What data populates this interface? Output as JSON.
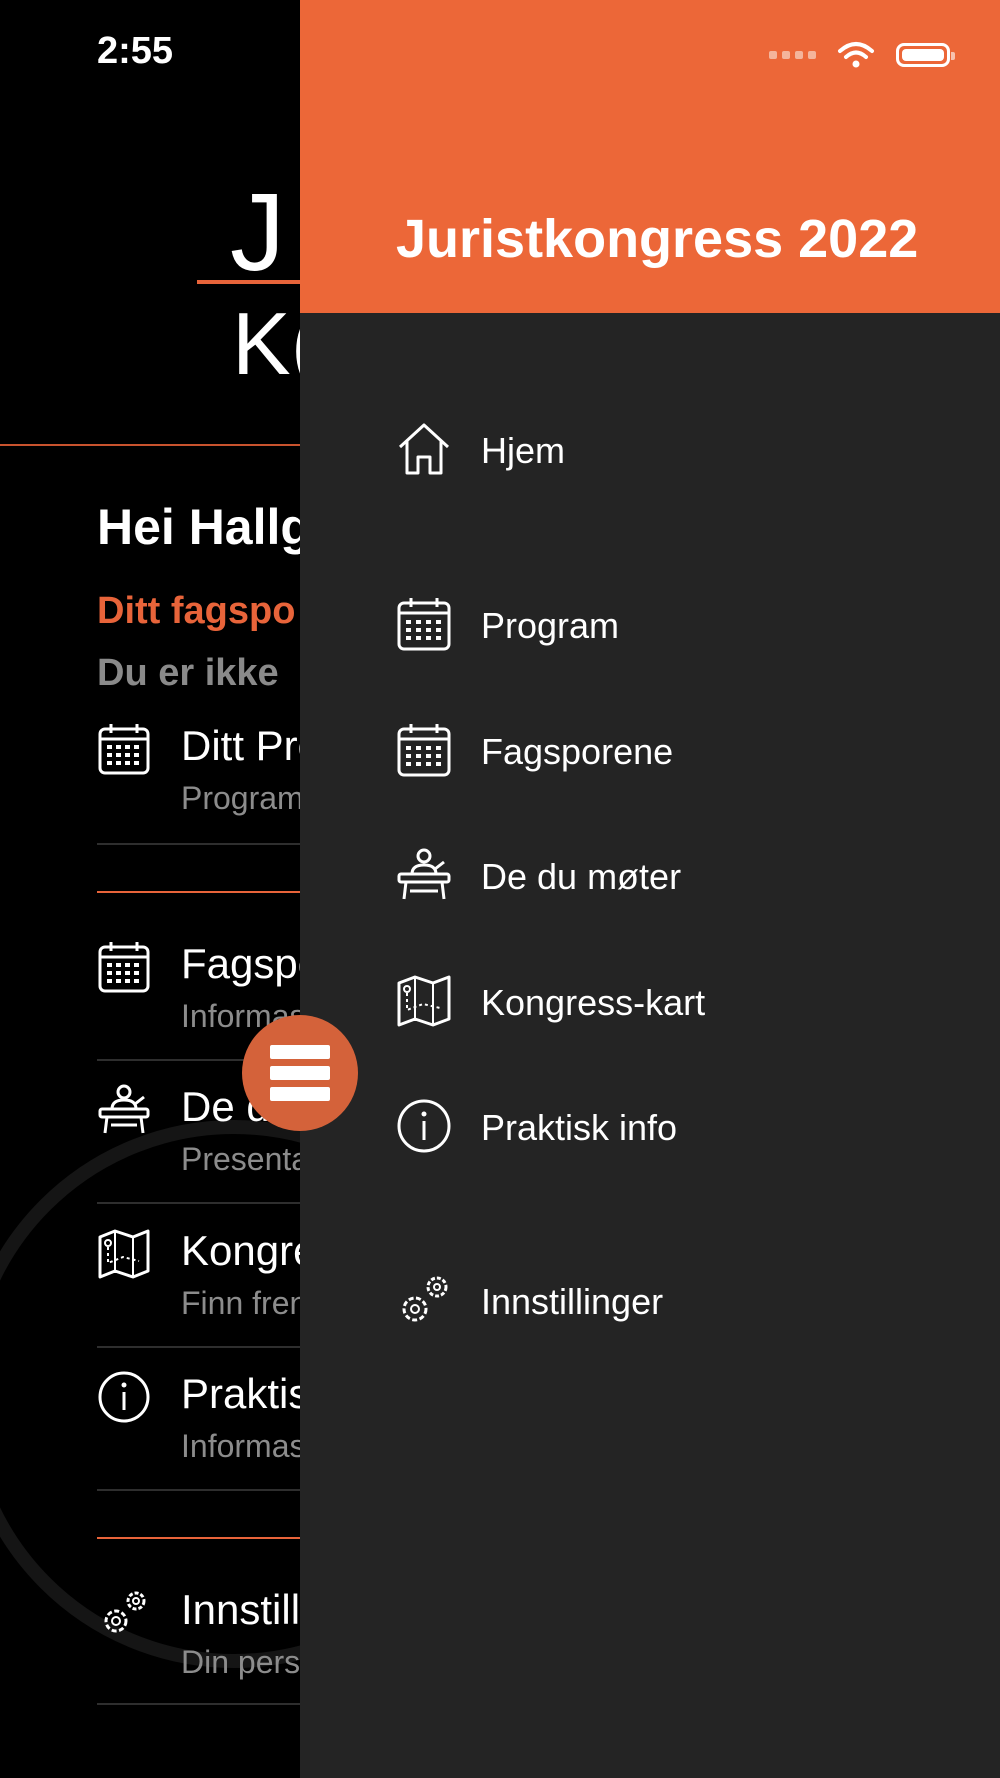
{
  "status_bar": {
    "time": "2:55"
  },
  "background": {
    "logo_line1": "J",
    "logo_line2": "K(",
    "greeting": "Hei Hallg",
    "fagspor_title": "Ditt fagspo",
    "fagspor_sub": "Du er ikke",
    "rows": [
      {
        "title": "Ditt Pro",
        "subtitle": "Program",
        "icon": "calendar-icon"
      },
      {
        "title": "Fagspo",
        "subtitle": "Informas",
        "icon": "calendar-icon"
      },
      {
        "title": "De d",
        "subtitle": "Presenta",
        "icon": "speaker-icon"
      },
      {
        "title": "Kongre",
        "subtitle": "Finn fren",
        "icon": "map-icon"
      },
      {
        "title": "Praktis",
        "subtitle": "Informas",
        "icon": "info-icon"
      },
      {
        "title": "Innstilli",
        "subtitle": "Din pers",
        "icon": "gears-icon"
      }
    ]
  },
  "drawer": {
    "title": "Juristkongress 2022",
    "items": [
      {
        "label": "Hjem",
        "icon": "home-icon"
      },
      {
        "label": "Program",
        "icon": "calendar-icon"
      },
      {
        "label": "Fagsporene",
        "icon": "calendar-icon"
      },
      {
        "label": "De du møter",
        "icon": "speaker-icon"
      },
      {
        "label": "Kongress-kart",
        "icon": "map-icon"
      },
      {
        "label": "Praktisk info",
        "icon": "info-icon"
      },
      {
        "label": "Innstillinger",
        "icon": "gears-icon"
      }
    ]
  },
  "colors": {
    "accent": "#ec6738",
    "drawer_bg": "#242424",
    "background": "#000000"
  }
}
